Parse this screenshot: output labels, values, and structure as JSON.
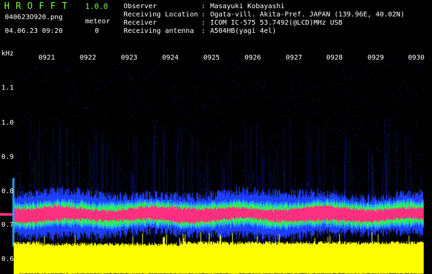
{
  "header": {
    "app_title": "HROFFT",
    "app_version": "1.0.0",
    "filename": "040623O920.png",
    "datetime": "04.06.23 09:20",
    "meteor_label": "meteor",
    "meteor_count": "0"
  },
  "info": [
    {
      "key": "Observer",
      "value": "Masayuki Kobayashi"
    },
    {
      "key": "Receiving Location",
      "value": "Ogata-vill. Akita-Pref. JAPAN (139.96E, 40.02N)"
    },
    {
      "key": "Receiver",
      "value": "ICOM IC-575 53.7492(@LCD)MHz USB"
    },
    {
      "key": "Receiving antenna",
      "value": "A504HB(yagi 4el)"
    }
  ],
  "axis": {
    "unit_label": "kHz",
    "freq_labels": [
      "1.1",
      "1.0",
      "0.9",
      "0.8",
      "0.7",
      "0.6"
    ],
    "time_labels": [
      "0921",
      "0922",
      "0923",
      "0924",
      "0925",
      "0926",
      "0927",
      "0928",
      "0929",
      "0930"
    ]
  },
  "colors": {
    "title_green": "#7fff3f",
    "noise_floor_yellow": "#ffff00",
    "carrier_pink": "#ff2f7f",
    "halo_green": "#2fef5f",
    "noise_blue": "#1f3fff"
  }
}
